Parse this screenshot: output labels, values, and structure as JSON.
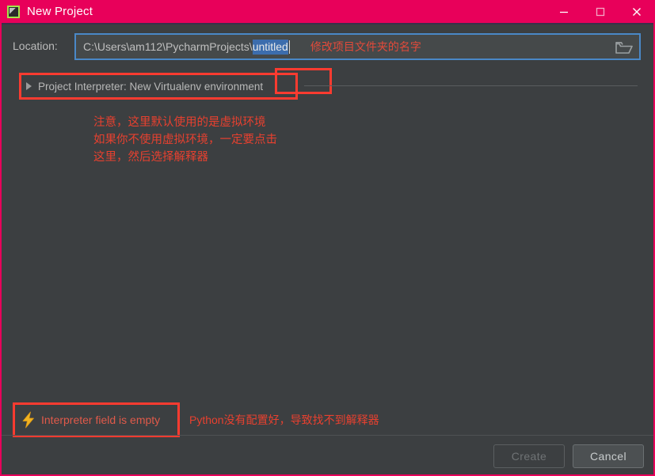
{
  "window": {
    "title": "New Project",
    "app_icon": "pycharm-icon",
    "titlebar_color": "#e8005a",
    "background_color": "#3c3f41",
    "annotation_color": "#fc3b30",
    "controls": {
      "minimize": "minimize-icon",
      "maximize": "maximize-icon",
      "close": "close-icon"
    }
  },
  "location": {
    "label": "Location:",
    "path_prefix": "C:\\Users\\am112\\PycharmProjects\\",
    "selected_text": "untitled",
    "full_value": "C:\\Users\\am112\\PycharmProjects\\untitled",
    "browse_icon": "folder-icon",
    "annotation": "修改项目文件夹的名字",
    "selection_color": "#3c6dad",
    "focus_border_color": "#4a88c7"
  },
  "interpreter": {
    "expand_icon": "chevron-right-icon",
    "label": "Project Interpreter: New Virtualenv environment",
    "expanded": false
  },
  "notes": {
    "line1": "注意，这里默认使用的是虚拟环境",
    "line2": "如果你不使用虚拟环境，一定要点击",
    "line3": "这里，然后选择解释器"
  },
  "error": {
    "icon": "warning-bolt-icon",
    "message": "Interpreter field is empty",
    "annotation": "Python没有配置好，导致找不到解释器",
    "text_color": "#e05a4a"
  },
  "footer": {
    "create_label": "Create",
    "create_enabled": false,
    "cancel_label": "Cancel",
    "cancel_enabled": true
  }
}
